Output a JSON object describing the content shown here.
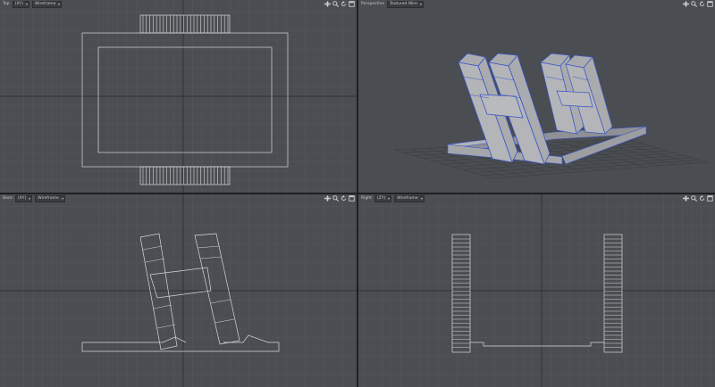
{
  "viewports": [
    {
      "id": "top",
      "view_label": "Top",
      "mode": "(XY)",
      "shading": "Wireframe"
    },
    {
      "id": "perspective",
      "view_label": "Perspective",
      "mode": "",
      "shading": "Textured Wire"
    },
    {
      "id": "back",
      "view_label": "Back",
      "mode": "(XY)",
      "shading": "Wireframe"
    },
    {
      "id": "right",
      "view_label": "Right",
      "mode": "(ZY)",
      "shading": "Wireframe"
    }
  ],
  "icons": [
    "move-icon",
    "zoom-icon",
    "rotate-icon",
    "maximize-icon"
  ],
  "colors": {
    "viewport_bg": "#4a4d51",
    "grid_minor": "#55585c",
    "grid_major": "#2e3033",
    "wire": "#d8d8d8",
    "mesh_fill": "#a9abae",
    "mesh_edge": "#3b55c8"
  }
}
